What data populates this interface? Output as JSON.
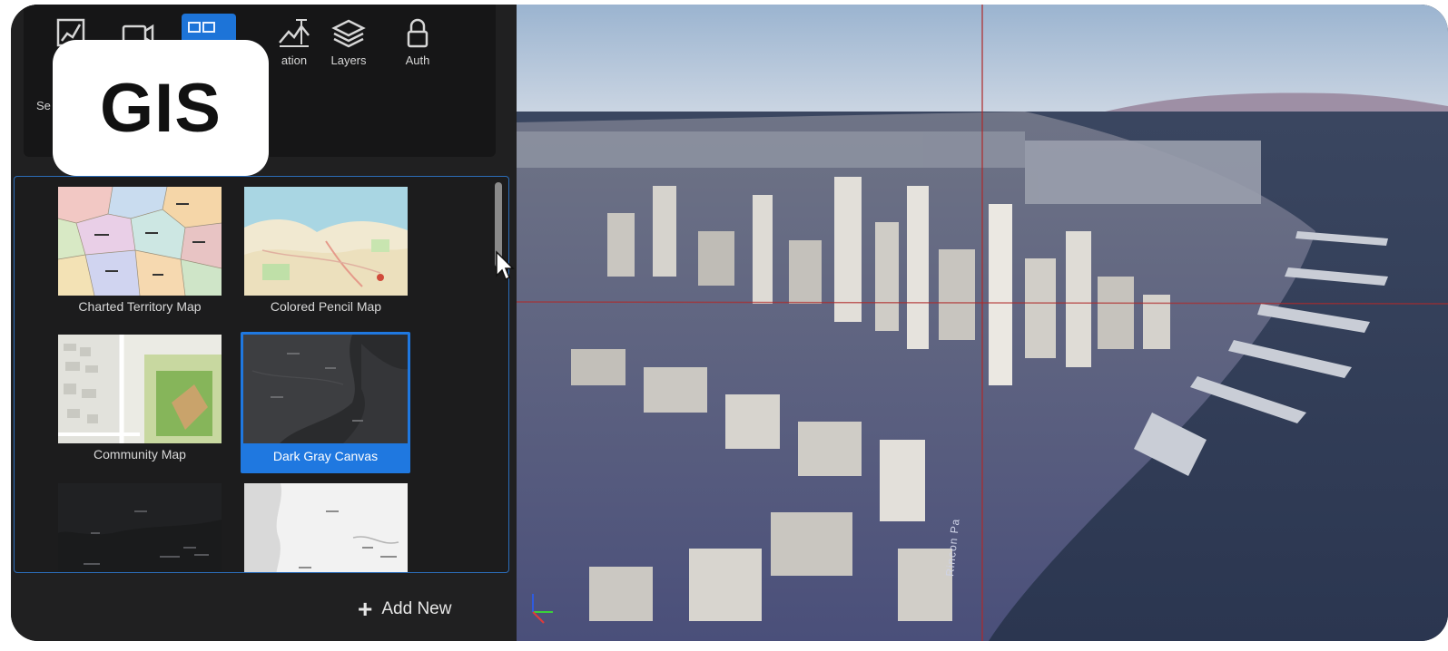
{
  "badge": {
    "label": "GIS"
  },
  "toolbar": {
    "tools": [
      {
        "name": "draw-tool",
        "label": ""
      },
      {
        "name": "camera-tool",
        "label": ""
      },
      {
        "name": "basemap-tool",
        "label": ""
      },
      {
        "name": "elevation-tool",
        "label": "ation"
      },
      {
        "name": "layers-tool",
        "label": "Layers"
      },
      {
        "name": "auth-tool",
        "label": "Auth"
      }
    ],
    "partial_label": "Se"
  },
  "gallery": {
    "items": [
      {
        "label": "Charted Territory Map",
        "selected": false
      },
      {
        "label": "Colored Pencil Map",
        "selected": false
      },
      {
        "label": "Community Map",
        "selected": false
      },
      {
        "label": "Dark Gray Canvas",
        "selected": true
      },
      {
        "label": "",
        "selected": false
      },
      {
        "label": "",
        "selected": false
      }
    ]
  },
  "actions": {
    "add_new_label": "Add New",
    "add_new_icon": "plus-icon"
  },
  "colors": {
    "accent": "#1f78e0",
    "panel": "#202021",
    "crosshair": "#b02a2a"
  },
  "viewport": {
    "street_label": "Rincon Pa"
  }
}
